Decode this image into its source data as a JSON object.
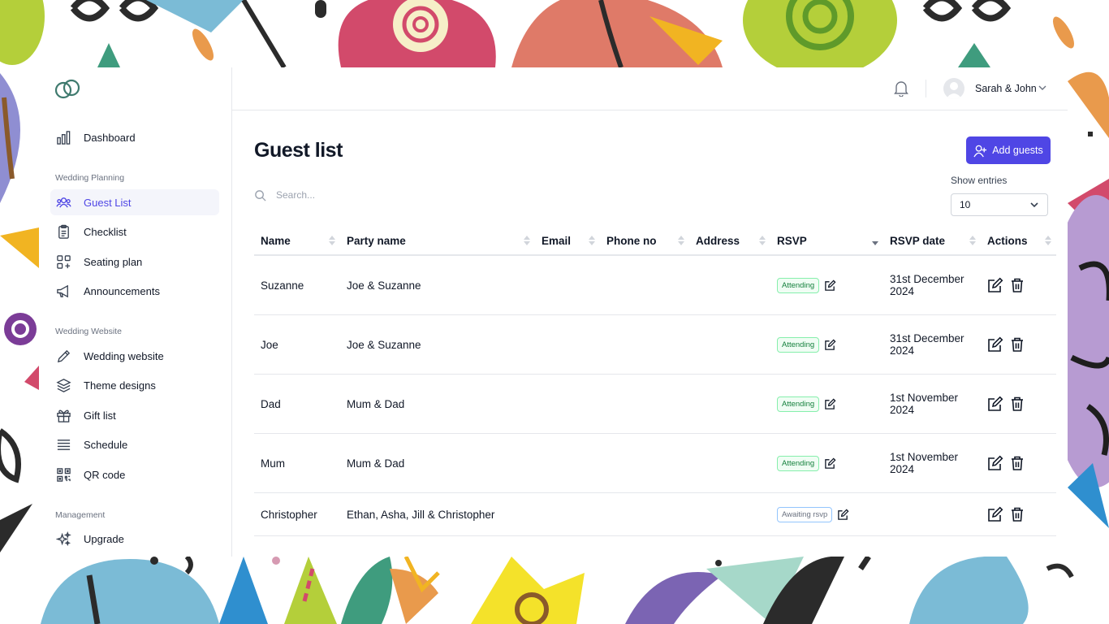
{
  "app": {
    "user_name": "Sarah & John"
  },
  "sidebar": {
    "items_top": [
      {
        "label": "Dashboard",
        "icon": "bar-chart-icon"
      }
    ],
    "sections": [
      {
        "heading": "Wedding Planning",
        "items": [
          {
            "label": "Guest List",
            "icon": "users-icon",
            "active": true
          },
          {
            "label": "Checklist",
            "icon": "clipboard-icon"
          },
          {
            "label": "Seating plan",
            "icon": "grid-plus-icon"
          },
          {
            "label": "Announcements",
            "icon": "megaphone-icon"
          }
        ]
      },
      {
        "heading": "Wedding Website",
        "items": [
          {
            "label": "Wedding website",
            "icon": "pencil-icon"
          },
          {
            "label": "Theme designs",
            "icon": "layers-icon"
          },
          {
            "label": "Gift list",
            "icon": "gift-icon"
          },
          {
            "label": "Schedule",
            "icon": "list-icon"
          },
          {
            "label": "QR code",
            "icon": "qr-code-icon"
          }
        ]
      },
      {
        "heading": "Management",
        "items": [
          {
            "label": "Upgrade",
            "icon": "sparkles-icon"
          }
        ]
      }
    ]
  },
  "page": {
    "title": "Guest list",
    "add_label": "Add guests",
    "search_placeholder": "Search...",
    "show_label": "Show entries",
    "show_value": "10"
  },
  "table": {
    "columns": [
      "Name",
      "Party name",
      "Email",
      "Phone no",
      "Address",
      "RSVP",
      "RSVP date",
      "Actions"
    ],
    "rows": [
      {
        "name": "Suzanne",
        "party": "Joe & Suzanne",
        "email": "",
        "phone": "",
        "address": "",
        "rsvp": "Attending",
        "rsvp_date_1": "31st December",
        "rsvp_date_2": "2024"
      },
      {
        "name": "Joe",
        "party": "Joe & Suzanne",
        "email": "",
        "phone": "",
        "address": "",
        "rsvp": "Attending",
        "rsvp_date_1": "31st December",
        "rsvp_date_2": "2024"
      },
      {
        "name": "Dad",
        "party": "Mum & Dad",
        "email": "",
        "phone": "",
        "address": "",
        "rsvp": "Attending",
        "rsvp_date_1": "1st November",
        "rsvp_date_2": "2024"
      },
      {
        "name": "Mum",
        "party": "Mum & Dad",
        "email": "",
        "phone": "",
        "address": "",
        "rsvp": "Attending",
        "rsvp_date_1": "1st November",
        "rsvp_date_2": "2024"
      },
      {
        "name": "Christopher",
        "party": "Ethan, Asha, Jill & Christopher",
        "email": "",
        "phone": "",
        "address": "",
        "rsvp": "Awaiting rsvp",
        "rsvp_date_1": "",
        "rsvp_date_2": ""
      }
    ]
  },
  "colors": {
    "accent": "#4f46e5",
    "attending": "#15803d",
    "awaiting_border": "#93c5fd"
  }
}
